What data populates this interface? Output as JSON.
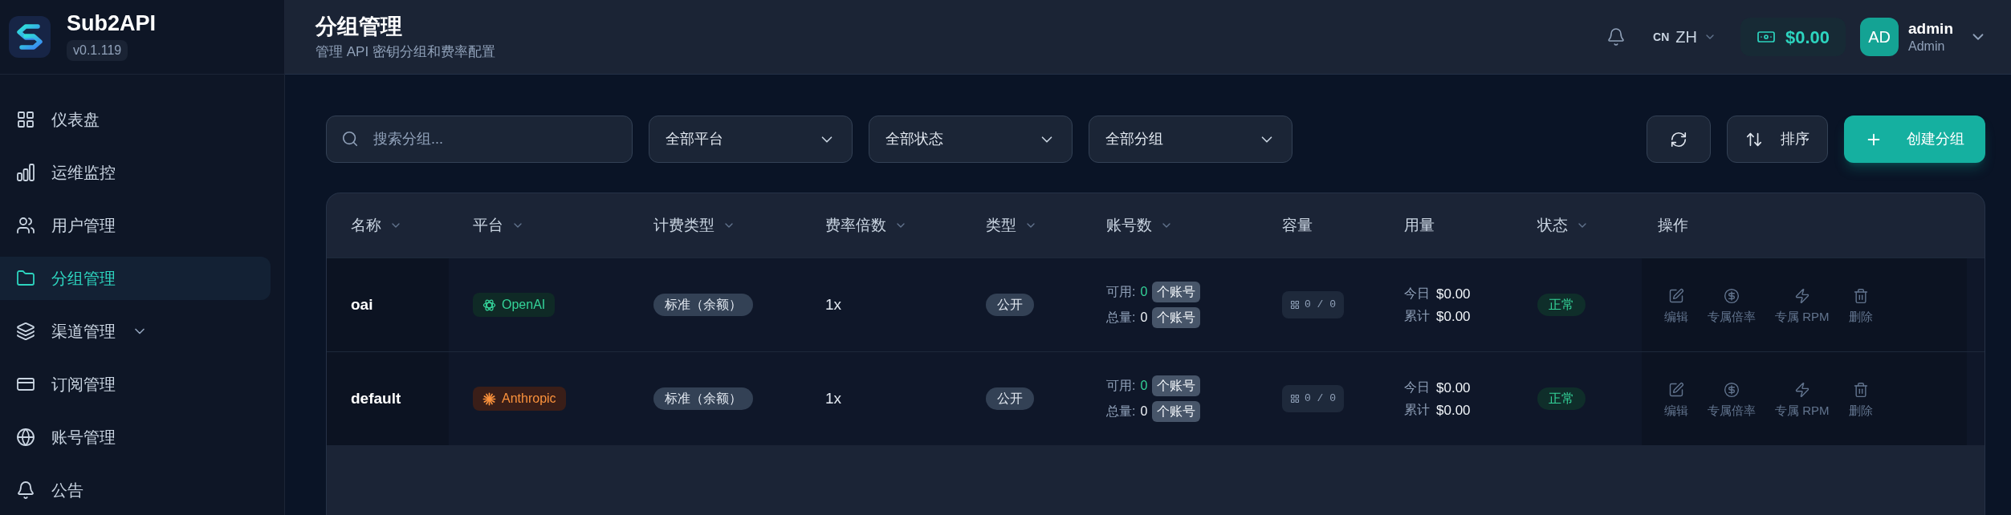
{
  "sidebar": {
    "brand": {
      "name": "Sub2API",
      "version": "v0.1.119"
    },
    "items": [
      {
        "label": "仪表盘",
        "selected": false
      },
      {
        "label": "运维监控",
        "selected": false
      },
      {
        "label": "用户管理",
        "selected": false
      },
      {
        "label": "分组管理",
        "selected": true
      },
      {
        "label": "渠道管理",
        "selected": false,
        "expanded": false
      },
      {
        "label": "订阅管理",
        "selected": false
      },
      {
        "label": "账号管理",
        "selected": false
      },
      {
        "label": "公告",
        "selected": false
      }
    ]
  },
  "header": {
    "title": "分组管理",
    "subtitle": "管理 API 密钥分组和费率配置",
    "language": {
      "region": "CN",
      "code": "ZH"
    },
    "balance": "$0.00",
    "user": {
      "initials": "AD",
      "name": "admin",
      "role": "Admin"
    }
  },
  "toolbar": {
    "search": {
      "placeholder": "搜索分组..."
    },
    "filters": [
      "全部平台",
      "全部状态",
      "全部分组"
    ],
    "sort": "排序",
    "create": "创建分组"
  },
  "table": {
    "columns": [
      {
        "label": "名称",
        "sortable": true
      },
      {
        "label": "平台",
        "sortable": true
      },
      {
        "label": "计费类型",
        "sortable": true
      },
      {
        "label": "费率倍数",
        "sortable": true
      },
      {
        "label": "类型",
        "sortable": true
      },
      {
        "label": "账号数",
        "sortable": true
      },
      {
        "label": "容量",
        "sortable": false
      },
      {
        "label": "用量",
        "sortable": false
      },
      {
        "label": "状态",
        "sortable": true
      },
      {
        "label": "操作",
        "sortable": false
      }
    ],
    "rows": [
      {
        "name": "oai",
        "platform": {
          "label": "OpenAI",
          "kind": "openai"
        },
        "billing": "标准（余额）",
        "rate": "1x",
        "type": "公开",
        "accounts": {
          "available": {
            "label": "可用:",
            "count": "0",
            "unit": "个账号"
          },
          "total": {
            "label": "总量:",
            "count": "0",
            "unit": "个账号"
          }
        },
        "capacity": "0 / 0",
        "usage": {
          "today": {
            "label": "今日",
            "value": "$0.00"
          },
          "total": {
            "label": "累计",
            "value": "$0.00"
          }
        },
        "status": "正常",
        "actions": [
          "编辑",
          "专属倍率",
          "专属 RPM",
          "删除"
        ]
      },
      {
        "name": "default",
        "platform": {
          "label": "Anthropic",
          "kind": "anthropic"
        },
        "billing": "标准（余额）",
        "rate": "1x",
        "type": "公开",
        "accounts": {
          "available": {
            "label": "可用:",
            "count": "0",
            "unit": "个账号"
          },
          "total": {
            "label": "总量:",
            "count": "0",
            "unit": "个账号"
          }
        },
        "capacity": "0 / 0",
        "usage": {
          "today": {
            "label": "今日",
            "value": "$0.00"
          },
          "total": {
            "label": "累计",
            "value": "$0.00"
          }
        },
        "status": "正常",
        "actions": [
          "编辑",
          "专属倍率",
          "专属 RPM",
          "删除"
        ]
      }
    ]
  }
}
